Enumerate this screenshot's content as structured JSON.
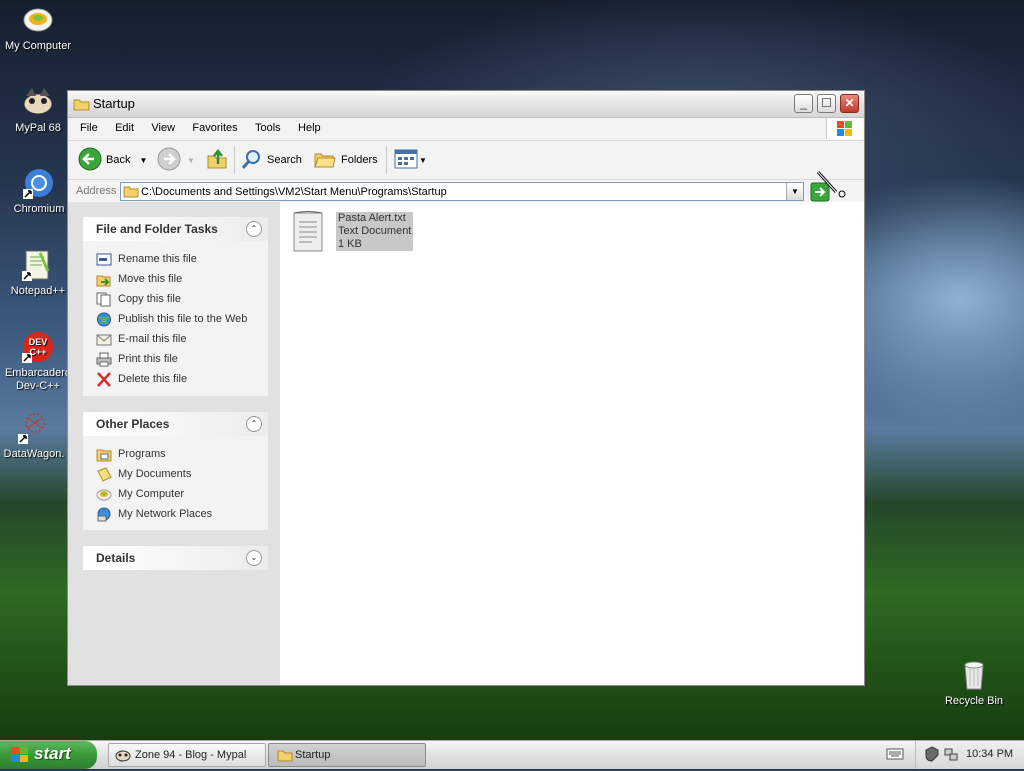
{
  "desktop": {
    "icons": [
      {
        "label": "My Computer"
      },
      {
        "label": "MyPal 68"
      },
      {
        "label": "Chromium"
      },
      {
        "label": "Notepad++"
      },
      {
        "label": "Embarcadero Dev-C++"
      },
      {
        "label": "DataWagon."
      },
      {
        "label": "Recycle Bin"
      }
    ]
  },
  "window": {
    "title": "Startup",
    "menu": [
      "File",
      "Edit",
      "View",
      "Favorites",
      "Tools",
      "Help"
    ],
    "toolbar": {
      "back": "Back",
      "search": "Search",
      "folders": "Folders"
    },
    "address": {
      "label": "Address",
      "path": "C:\\Documents and Settings\\VM2\\Start Menu\\Programs\\Startup"
    },
    "tasks_panel": {
      "title": "File and Folder Tasks",
      "items": [
        "Rename this file",
        "Move this file",
        "Copy this file",
        "Publish this file to the Web",
        "E-mail this file",
        "Print this file",
        "Delete this file"
      ]
    },
    "places_panel": {
      "title": "Other Places",
      "items": [
        "Programs",
        "My Documents",
        "My Computer",
        "My Network Places"
      ]
    },
    "details_panel": {
      "title": "Details"
    },
    "file": {
      "name": "Pasta Alert.txt",
      "type": "Text Document",
      "size": "1 KB"
    }
  },
  "taskbar": {
    "start": "start",
    "tasks": [
      {
        "label": "Zone 94 - Blog - Mypal"
      },
      {
        "label": "Startup"
      }
    ],
    "clock": "10:34 PM"
  }
}
